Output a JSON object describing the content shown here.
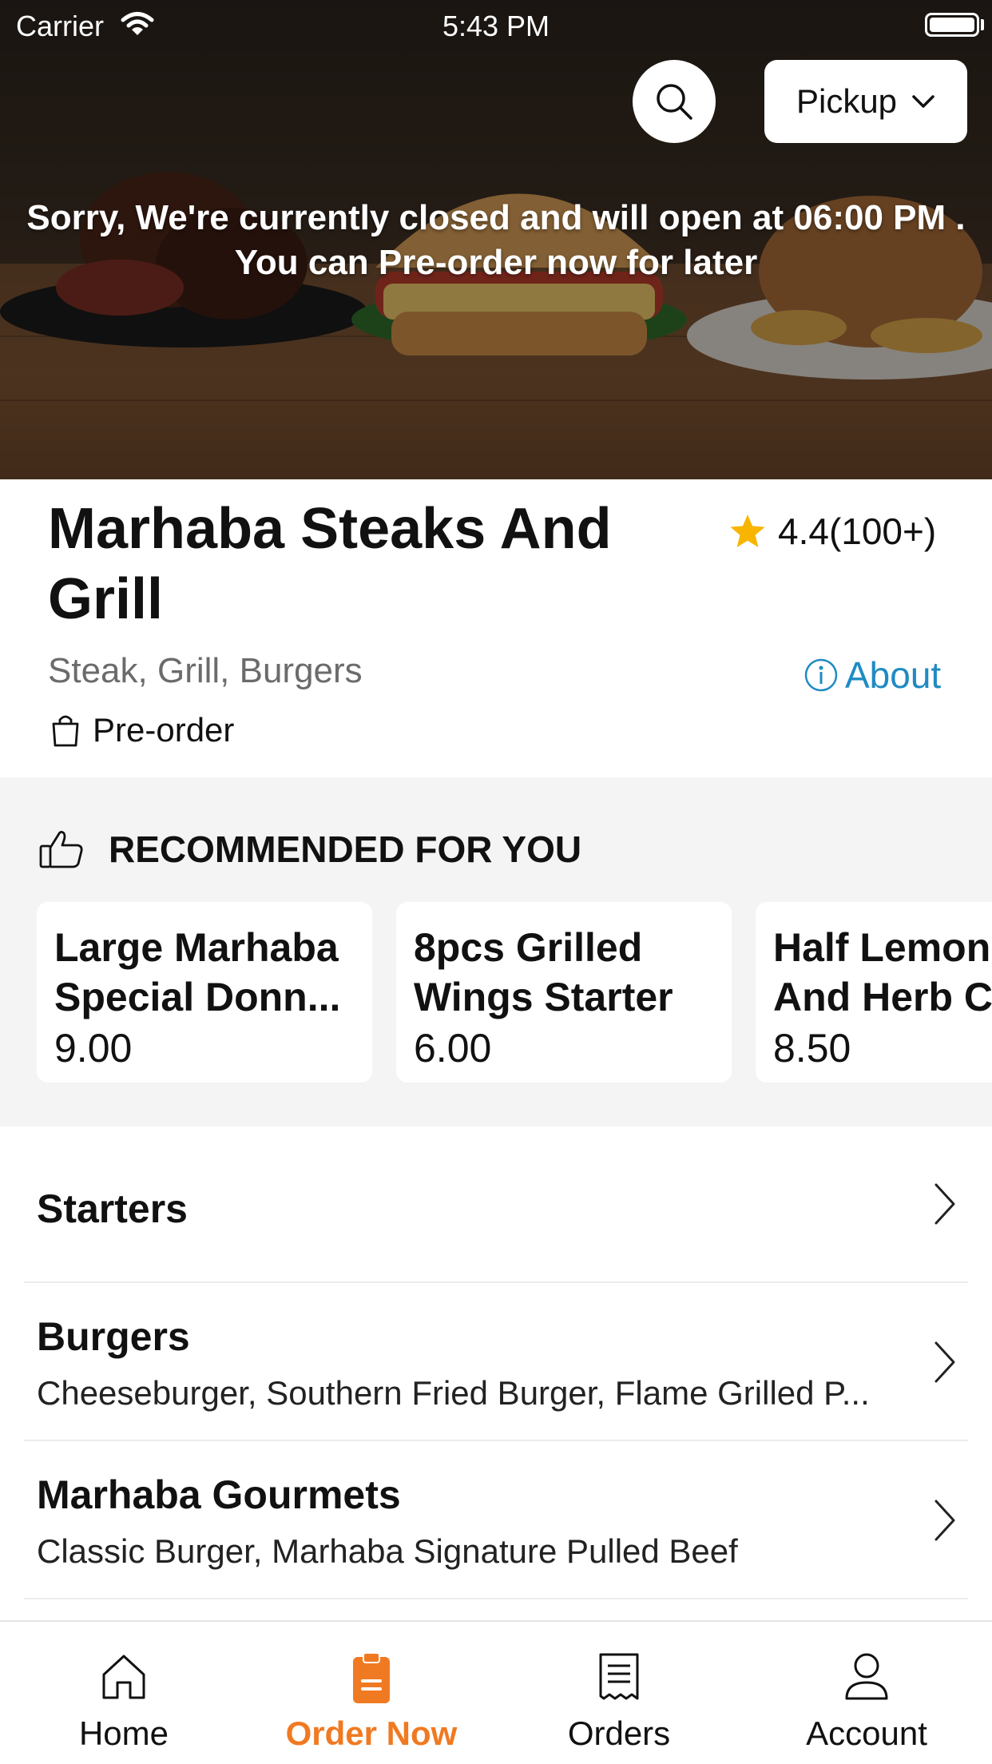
{
  "status_bar": {
    "carrier": "Carrier",
    "time": "5:43 PM"
  },
  "header": {
    "pickup_label": "Pickup",
    "closed_line1": "Sorry, We're currently closed and will open at 06:00 PM .",
    "closed_line2": "You can Pre-order now for later"
  },
  "restaurant": {
    "name": "Marhaba Steaks And Grill",
    "rating": "4.4(100+)",
    "cuisines": "Steak, Grill, Burgers",
    "about_label": "About",
    "preorder_label": "Pre-order"
  },
  "recommended": {
    "title": "RECOMMENDED FOR YOU",
    "items": [
      {
        "name_line1": "Large Marhaba",
        "name_line2": "Special Donn...",
        "price": "9.00"
      },
      {
        "name_line1": "8pcs Grilled",
        "name_line2": "Wings Starter",
        "price": "6.00"
      },
      {
        "name_line1": "Half Lemon",
        "name_line2": "And Herb C",
        "price": "8.50"
      }
    ]
  },
  "categories": [
    {
      "title": "Starters",
      "subtitle": ""
    },
    {
      "title": "Burgers",
      "subtitle": "Cheeseburger, Southern Fried Burger, Flame Grilled P..."
    },
    {
      "title": "Marhaba Gourmets",
      "subtitle": "Classic Burger, Marhaba Signature Pulled Beef"
    }
  ],
  "tabs": [
    {
      "label": "Home",
      "icon": "home-icon",
      "active": false
    },
    {
      "label": "Order Now",
      "icon": "order-icon",
      "active": true
    },
    {
      "label": "Orders",
      "icon": "receipt-icon",
      "active": false
    },
    {
      "label": "Account",
      "icon": "user-icon",
      "active": false
    }
  ],
  "colors": {
    "accent": "#f07a22",
    "link": "#1f8bc2",
    "star": "#f7b500",
    "section_bg": "#f4f4f4"
  }
}
